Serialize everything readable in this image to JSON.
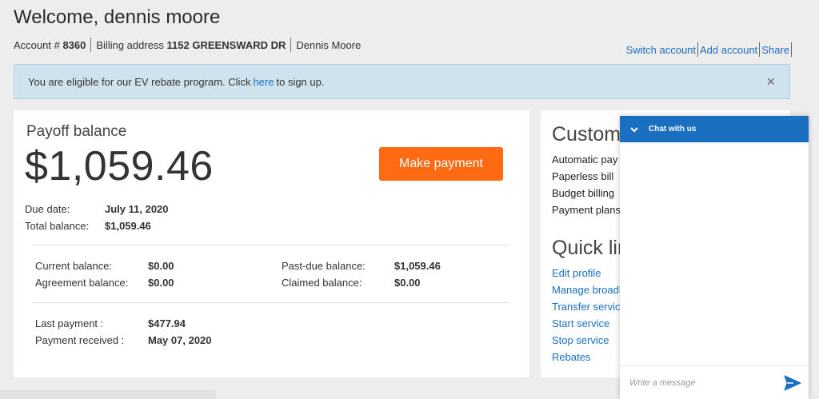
{
  "header": {
    "welcome": "Welcome, dennis moore",
    "account_label": "Account #",
    "account_number": "8360",
    "billing_label": "Billing address",
    "billing_address": "1152 GREENSWARD DR",
    "name": "Dennis Moore"
  },
  "top_links": {
    "switch_account": "Switch account",
    "add_account": "Add account",
    "share": "Share"
  },
  "banner": {
    "text_before": "You are eligible for our EV rebate program. Click",
    "link": "here",
    "text_after": "to sign up.",
    "close_glyph": "×"
  },
  "payoff": {
    "label": "Payoff balance",
    "amount": "$1,059.46",
    "button": "Make payment",
    "due_date_label": "Due date:",
    "due_date": "July 11, 2020",
    "total_label": "Total balance:",
    "total": "$1,059.46",
    "current_label": "Current balance:",
    "current": "$0.00",
    "agreement_label": "Agreement balance:",
    "agreement": "$0.00",
    "pastdue_label": "Past-due balance:",
    "pastdue": "$1,059.46",
    "claimed_label": "Claimed balance:",
    "claimed": "$0.00",
    "last_payment_label": "Last payment :",
    "last_payment": "$477.94",
    "received_label": "Payment received :",
    "received": "May 07, 2020"
  },
  "side": {
    "customer_title": "Customer",
    "customer_items": [
      "Automatic pay",
      "Paperless bill",
      "Budget billing",
      "Payment plans"
    ],
    "quick_title": "Quick links",
    "quick_links": [
      "Edit profile",
      "Manage broadband",
      "Transfer service",
      "Start service",
      "Stop service",
      "Rebates"
    ]
  },
  "chat": {
    "title": "Chat with us",
    "placeholder": "Write a message"
  },
  "colors": {
    "accent": "#1a6fc0",
    "button": "#ff6a13",
    "banner_bg": "#cfe3ee"
  }
}
